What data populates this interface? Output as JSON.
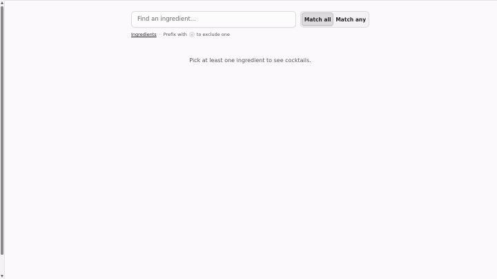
{
  "search": {
    "placeholder": "Find an ingredient...",
    "value": ""
  },
  "match_mode": {
    "options": [
      "Match all",
      "Match any"
    ],
    "selected": "Match all"
  },
  "hint": {
    "link_label": "Ingredients",
    "separator": "·",
    "prefix_text": "Prefix with",
    "key": "-",
    "suffix_text": "to exclude one"
  },
  "empty_state": {
    "message": "Pick at least one ingredient to see cocktails."
  }
}
